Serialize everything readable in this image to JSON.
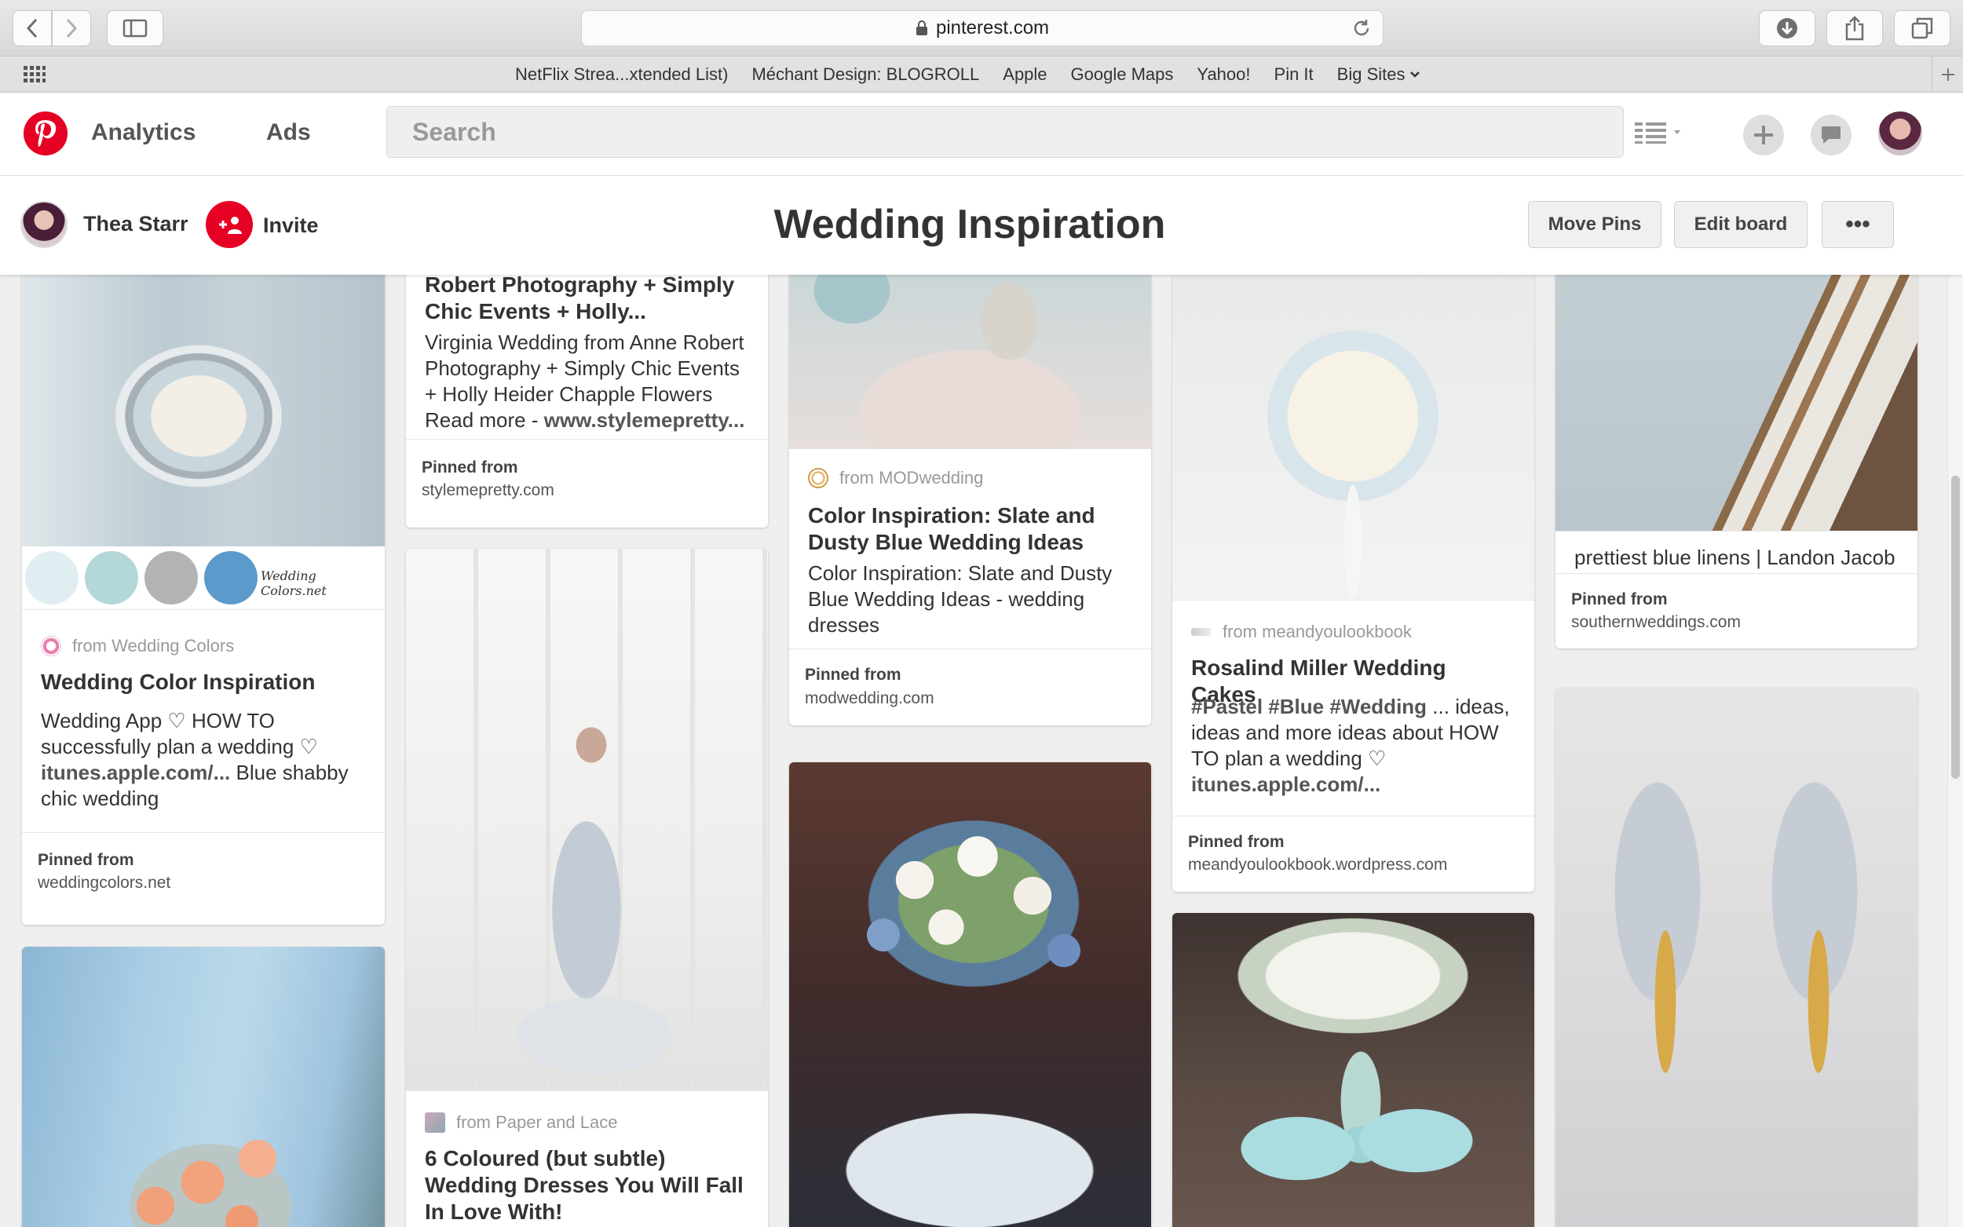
{
  "browser": {
    "url": "pinterest.com",
    "bookmarks": [
      "NetFlix Strea...xtended List)",
      "Méchant Design: BLOGROLL",
      "Apple",
      "Google Maps",
      "Yahoo!",
      "Pin It",
      "Big Sites"
    ]
  },
  "header": {
    "nav": [
      "Analytics",
      "Ads"
    ],
    "search_placeholder": "Search"
  },
  "board": {
    "owner": "Thea Starr",
    "invite_label": "Invite",
    "title": "Wedding Inspiration",
    "buttons": {
      "move_pins": "Move Pins",
      "edit_board": "Edit board",
      "more": "•••"
    }
  },
  "pins": {
    "p1": {
      "swatch_text": "Wedding Colors.net",
      "source": "from Wedding Colors",
      "title": "Wedding Color Inspiration",
      "desc_a": "Wedding App ♡ HOW TO successfully plan a wedding ♡",
      "desc_link": "itunes.apple.com/...",
      "desc_b": "Blue shabby chic wedding",
      "pinned_label": "Pinned from",
      "pinned_domain": "weddingcolors.net"
    },
    "p2": {
      "title": "Robert Photography + Simply Chic Events + Holly...",
      "desc": "Virginia Wedding from Anne Robert Photography + Simply Chic Events + Holly Heider Chapple Flowers Read more -",
      "desc_link": "www.stylemepretty...",
      "pinned_label": "Pinned from",
      "pinned_domain": "stylemepretty.com"
    },
    "p3": {
      "source": "from Paper and Lace",
      "title": "6 Coloured (but subtle) Wedding Dresses You Will Fall In Love With!"
    },
    "p4": {
      "source": "from MODwedding",
      "title": "Color Inspiration: Slate and Dusty Blue Wedding Ideas",
      "desc": "Color Inspiration: Slate and Dusty Blue Wedding Ideas - wedding dresses",
      "pinned_label": "Pinned from",
      "pinned_domain": "modwedding.com"
    },
    "p5": {
      "source": "from meandyoulookbook",
      "title": "Rosalind Miller Wedding Cakes",
      "desc_tags": "#Pastel #Blue #Wedding",
      "desc": "... ideas, ideas and more ideas about HOW TO plan a wedding ♡",
      "desc_link": "itunes.apple.com/...",
      "pinned_label": "Pinned from",
      "pinned_domain": "meandyoulookbook.wordpress.com"
    },
    "p6": {
      "desc": "prettiest blue linens | Landon Jacob",
      "pinned_label": "Pinned from",
      "pinned_domain": "southernweddings.com"
    }
  },
  "colors": {
    "brand": "#e60023",
    "swatches": [
      "#e1eef1",
      "#b4d8d9",
      "#b2b3b4",
      "#5b9acb"
    ]
  }
}
